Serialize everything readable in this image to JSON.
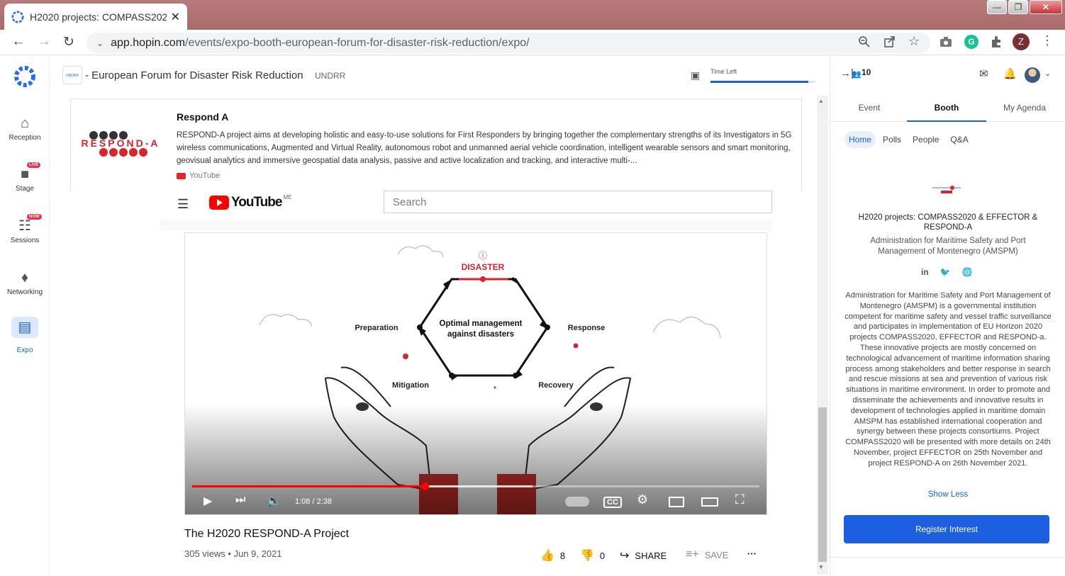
{
  "browser": {
    "tab_title": "H2020 projects: COMPASS2020 &",
    "tab_close": "✕",
    "url_host": "app.hopin.com",
    "url_path": "/events/expo-booth-european-forum-for-disaster-risk-reduction/expo/",
    "profile_initial": "Z",
    "window_buttons": {
      "minimize": "—",
      "maximize": "❐",
      "close": "✕"
    }
  },
  "leftnav": {
    "items": [
      {
        "label": "Reception",
        "icon": "home-icon",
        "badge": ""
      },
      {
        "label": "Stage",
        "icon": "camera-icon",
        "badge": "LIVE"
      },
      {
        "label": "Sessions",
        "icon": "sessions-icon",
        "badge": "NOW"
      },
      {
        "label": "Networking",
        "icon": "handshake-icon",
        "badge": ""
      },
      {
        "label": "Expo",
        "icon": "expo-icon",
        "badge": ""
      }
    ]
  },
  "topbar": {
    "booth_logo_text": "UNDRR",
    "event_title": "- European Forum for Disaster Risk Reduction",
    "organizer": "UNDRR",
    "time_left_label": "Time Left",
    "time_left_fraction": 0.93
  },
  "booth_card": {
    "title": "Respond A",
    "description": "RESPOND-A project aims at developing holistic and easy-to-use solutions for First Responders by bringing together the complementary strengths of its Investigators in 5G wireless communications, Augmented and Virtual Reality, autonomous robot and unmanned aerial vehicle coordination, intelligent wearable sensors and smart monitoring, geovisual analytics and immersive geospatial data analysis, passive and active localization and tracking, and interactive multi-...",
    "source": "YouTube",
    "logo_text": "RESPOND-A"
  },
  "youtube": {
    "logo_word": "YouTube",
    "region": "ME",
    "search_placeholder": "Search",
    "video": {
      "diagram_center": "Optimal management against disasters",
      "nodes": [
        "DISASTER",
        "Preparation",
        "Response",
        "Mitigation",
        "Recovery"
      ],
      "progress_fraction": 0.41,
      "buffered_fraction": 0.6,
      "time": "1:08 / 2:38"
    },
    "title": "The H2020 RESPOND-A Project",
    "meta": "305 views • Jun 9, 2021",
    "likes": "8",
    "dislikes": "0",
    "share_label": "SHARE",
    "save_label": "SAVE"
  },
  "sidebar": {
    "attendee_count": "10",
    "tabs": [
      "Event",
      "Booth",
      "My Agenda"
    ],
    "active_tab": "Booth",
    "subtabs": [
      "Home",
      "Polls",
      "People",
      "Q&A"
    ],
    "active_subtab": "Home",
    "booth_name": "H2020 projects: COMPASS2020 & EFFECTOR & RESPOND-A",
    "booth_org": "Administration for Maritime Safety and Port Management of Montenegro (AMSPM)",
    "social": [
      "in",
      "twitter-icon",
      "globe-icon"
    ],
    "description": "Administration for Maritime Safety and Port Management of Montenegro (AMSPM) is a governmental institution competent for maritime safety and vessel traffic surveillance and participates in implementation of EU Horizon 2020 projects COMPASS2020, EFFECTOR and RESPOND-a. These innovative projects are mostly concerned on technological advancement of maritime information sharing process among stakeholders and better response in search and rescue missions at sea and prevention of various risk situations in maritime environment. In order to promote and disseminate the achievements and innovative results in development of technologies applied in maritime domain AMSPM has established international cooperation and synergy between these projects consortiums. Project COMPASS2020 will be presented with more details on 24th November, project EFFECTOR on 25th November and project RESPOND-A on 26th November 2021.",
    "show_less": "Show Less",
    "register_button": "Register Interest"
  },
  "colors": {
    "accent": "#1c5fe0",
    "youtube_red": "#ff0000",
    "disaster_red": "#d9232d"
  }
}
